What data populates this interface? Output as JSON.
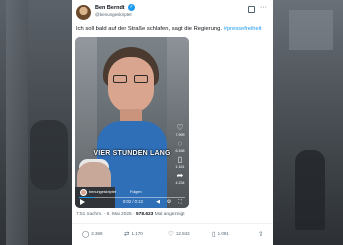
{
  "post": {
    "author_name": "Ben Berndt",
    "author_handle": "@benungeskriptet",
    "text": "Ich soll bald auf der Straße schlafen, sagt die Regierung.",
    "hashtag": "#pressefreiheit",
    "video_caption": "VIER STUNDEN LANG",
    "tiktok_user": "benungeskriptet",
    "tiktok_follow": "Folgen",
    "video_time": "0:02 / 0:13",
    "video_progress": 0.15,
    "side_counts": [
      "7.999",
      "6.168",
      "1.161",
      "4.234"
    ],
    "timestamp": "7:51 nachm. · 6. Mai 2025 ·",
    "views": "578.623",
    "views_label": "Mal angezeigt",
    "replies": "2.369",
    "reposts": "1.170",
    "likes": "12.842",
    "bookmarks": "1.091"
  },
  "colors": {
    "accent": "#1d9bf0",
    "text": "#0f1419",
    "muted": "#536471"
  },
  "icons": [
    "verified-icon",
    "grok-icon",
    "more-icon",
    "heart-icon",
    "comment-icon",
    "bookmark-icon",
    "share-icon",
    "play-icon",
    "volume-icon",
    "settings-icon",
    "fullscreen-icon",
    "reply-icon",
    "repost-icon",
    "like-icon",
    "share-action-icon"
  ]
}
